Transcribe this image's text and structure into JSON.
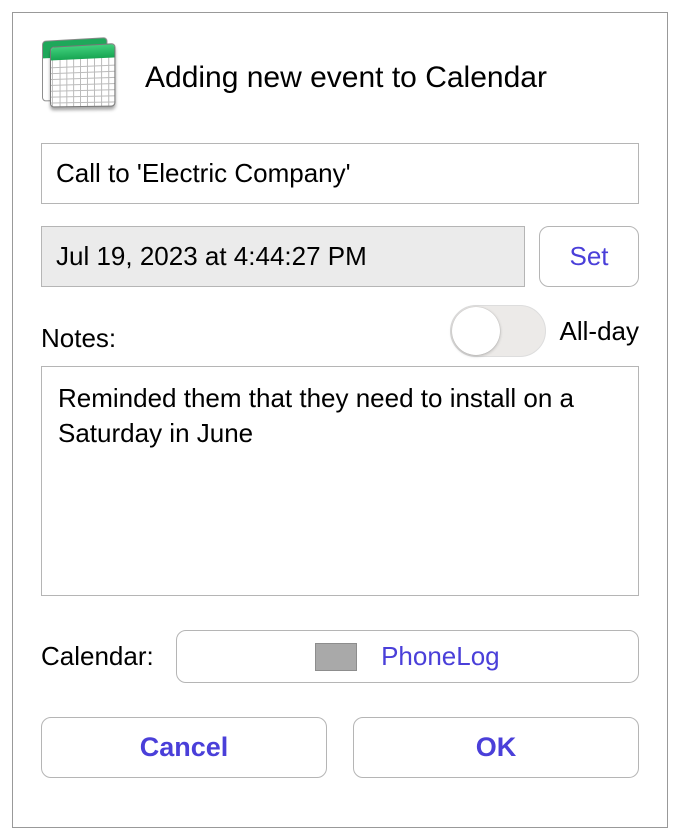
{
  "header": {
    "title": "Adding new event to Calendar"
  },
  "event": {
    "title_value": "Call to 'Electric Company'",
    "datetime_display": "Jul 19, 2023 at 4:44:27 PM",
    "notes_value": "Reminded them that they need to install on a Saturday in June",
    "all_day": false
  },
  "labels": {
    "set": "Set",
    "all_day": "All-day",
    "notes": "Notes:",
    "calendar": "Calendar:"
  },
  "calendar": {
    "selected_name": "PhoneLog",
    "swatch_color": "#a9a9a9"
  },
  "buttons": {
    "cancel": "Cancel",
    "ok": "OK"
  },
  "colors": {
    "accent": "#4a3fd9"
  }
}
